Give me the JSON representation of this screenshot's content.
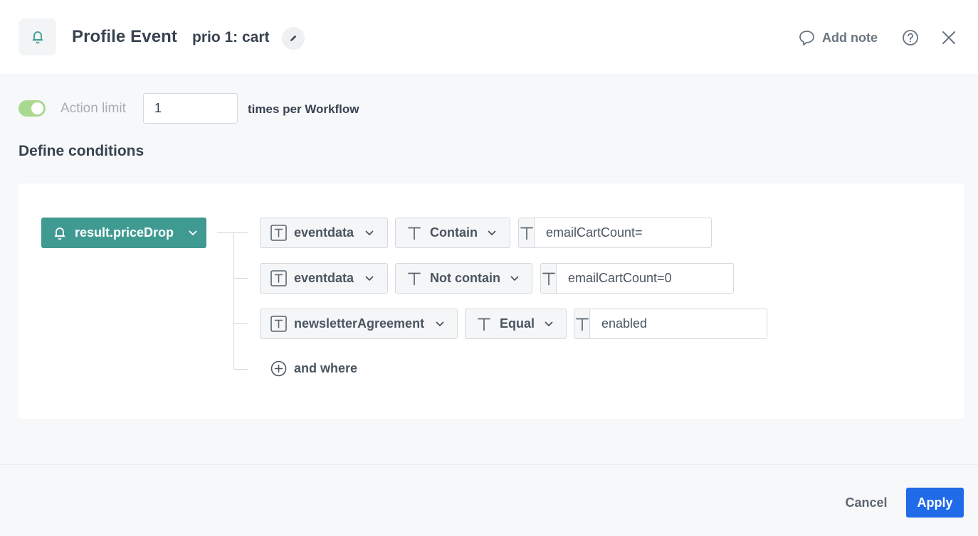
{
  "header": {
    "icon": "bell-icon",
    "title": "Profile Event",
    "subtitle": "prio 1: cart",
    "add_note_label": "Add note"
  },
  "action_limit": {
    "enabled": true,
    "label": "Action limit",
    "value": "1",
    "suffix": "times per Workflow"
  },
  "conditions": {
    "title": "Define conditions",
    "event": "result.priceDrop",
    "rows": [
      {
        "param": "eventdata",
        "operator": "Contain",
        "value": "emailCartCount="
      },
      {
        "param": "eventdata",
        "operator": "Not contain",
        "value": "emailCartCount=0"
      },
      {
        "param": "newsletterAgreement",
        "operator": "Equal",
        "value": "enabled"
      }
    ],
    "and_where_label": "and where"
  },
  "footer": {
    "cancel_label": "Cancel",
    "apply_label": "Apply"
  },
  "colors": {
    "accent": "#3f9a92",
    "primary_button": "#1f6be8",
    "toggle_on": "#a9d88f"
  }
}
